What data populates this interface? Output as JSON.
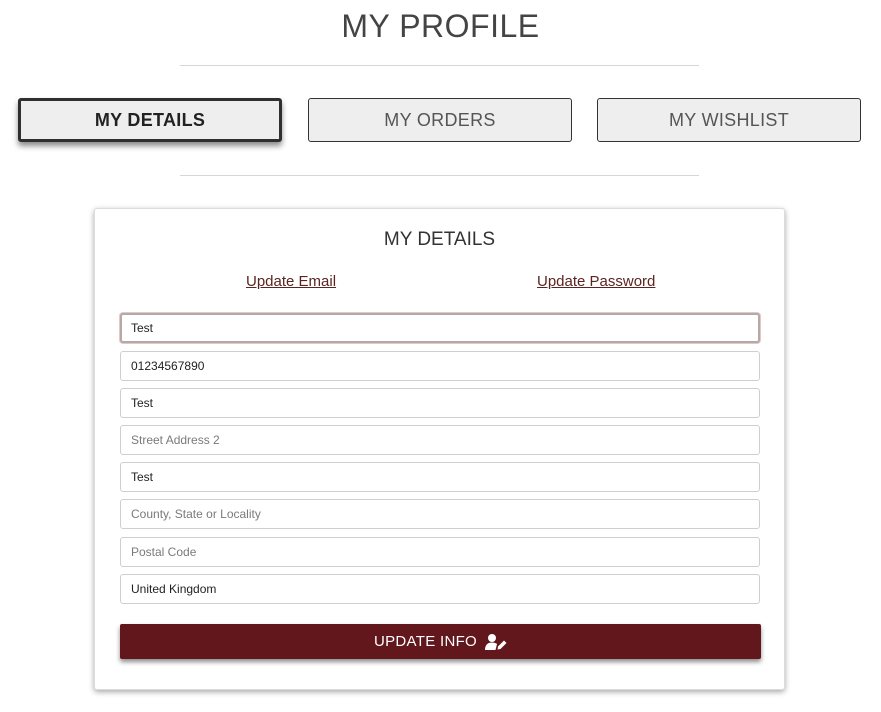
{
  "page": {
    "title": "MY PROFILE"
  },
  "tabs": [
    {
      "label": "MY DETAILS",
      "active": true
    },
    {
      "label": "MY ORDERS",
      "active": false
    },
    {
      "label": "MY WISHLIST",
      "active": false
    }
  ],
  "details": {
    "title": "MY DETAILS",
    "links": {
      "update_email": "Update Email",
      "update_password": "Update Password"
    },
    "fields": [
      {
        "value": "Test",
        "placeholder": ""
      },
      {
        "value": "01234567890",
        "placeholder": ""
      },
      {
        "value": "Test",
        "placeholder": ""
      },
      {
        "value": "",
        "placeholder": "Street Address 2"
      },
      {
        "value": "Test",
        "placeholder": ""
      },
      {
        "value": "",
        "placeholder": "County, State or Locality"
      },
      {
        "value": "",
        "placeholder": "Postal Code"
      },
      {
        "value": "United Kingdom",
        "placeholder": ""
      }
    ],
    "submit_label": "UPDATE INFO",
    "submit_icon": "user-edit-icon"
  },
  "colors": {
    "primary_button": "#62171c",
    "link": "#5b2420",
    "tab_background": "#eeeeee"
  }
}
